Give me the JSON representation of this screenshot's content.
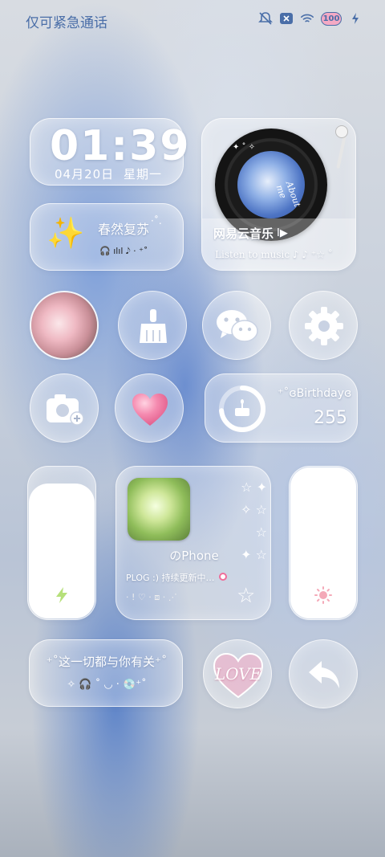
{
  "status_bar": {
    "left_text": "仅可紧急通话",
    "battery": "100"
  },
  "clock": {
    "time": "01:39",
    "date": "04月20日",
    "weekday": "星期一"
  },
  "spring": {
    "sparkle": "✨",
    "title": "春然复苏",
    "deco_a": "·˚.",
    "deco_b": "🎧 ılıl 𝅘𝅥𝅮 · ⁺˚"
  },
  "music": {
    "title": "网易云音乐",
    "play_glyph": "I▶",
    "subtitle": "Listen to music ♪ ♪ ⁺☆ ˚",
    "disc_text": "About me"
  },
  "birthday": {
    "label": "⁺˚ɞBirthdayɞ",
    "count": "255"
  },
  "iphone_widget": {
    "name": "のPhone",
    "caption": "PLOG :) 持续更新中…",
    "deco": "·  !  ♡  · ⧈  · ⋰"
  },
  "bottom_text": {
    "line1": "⁺˚这一切都与你有关⁺˚",
    "line2": "✧ 🎧 ˚ ◡ · 💿⁺˚"
  },
  "love": {
    "text": "LOVE"
  },
  "colors": {
    "accent_blue": "#4a6ea8",
    "charge_green": "#b6e07a",
    "sun_pink": "#f4a9b8",
    "heart_pink": "#f07aa0"
  }
}
